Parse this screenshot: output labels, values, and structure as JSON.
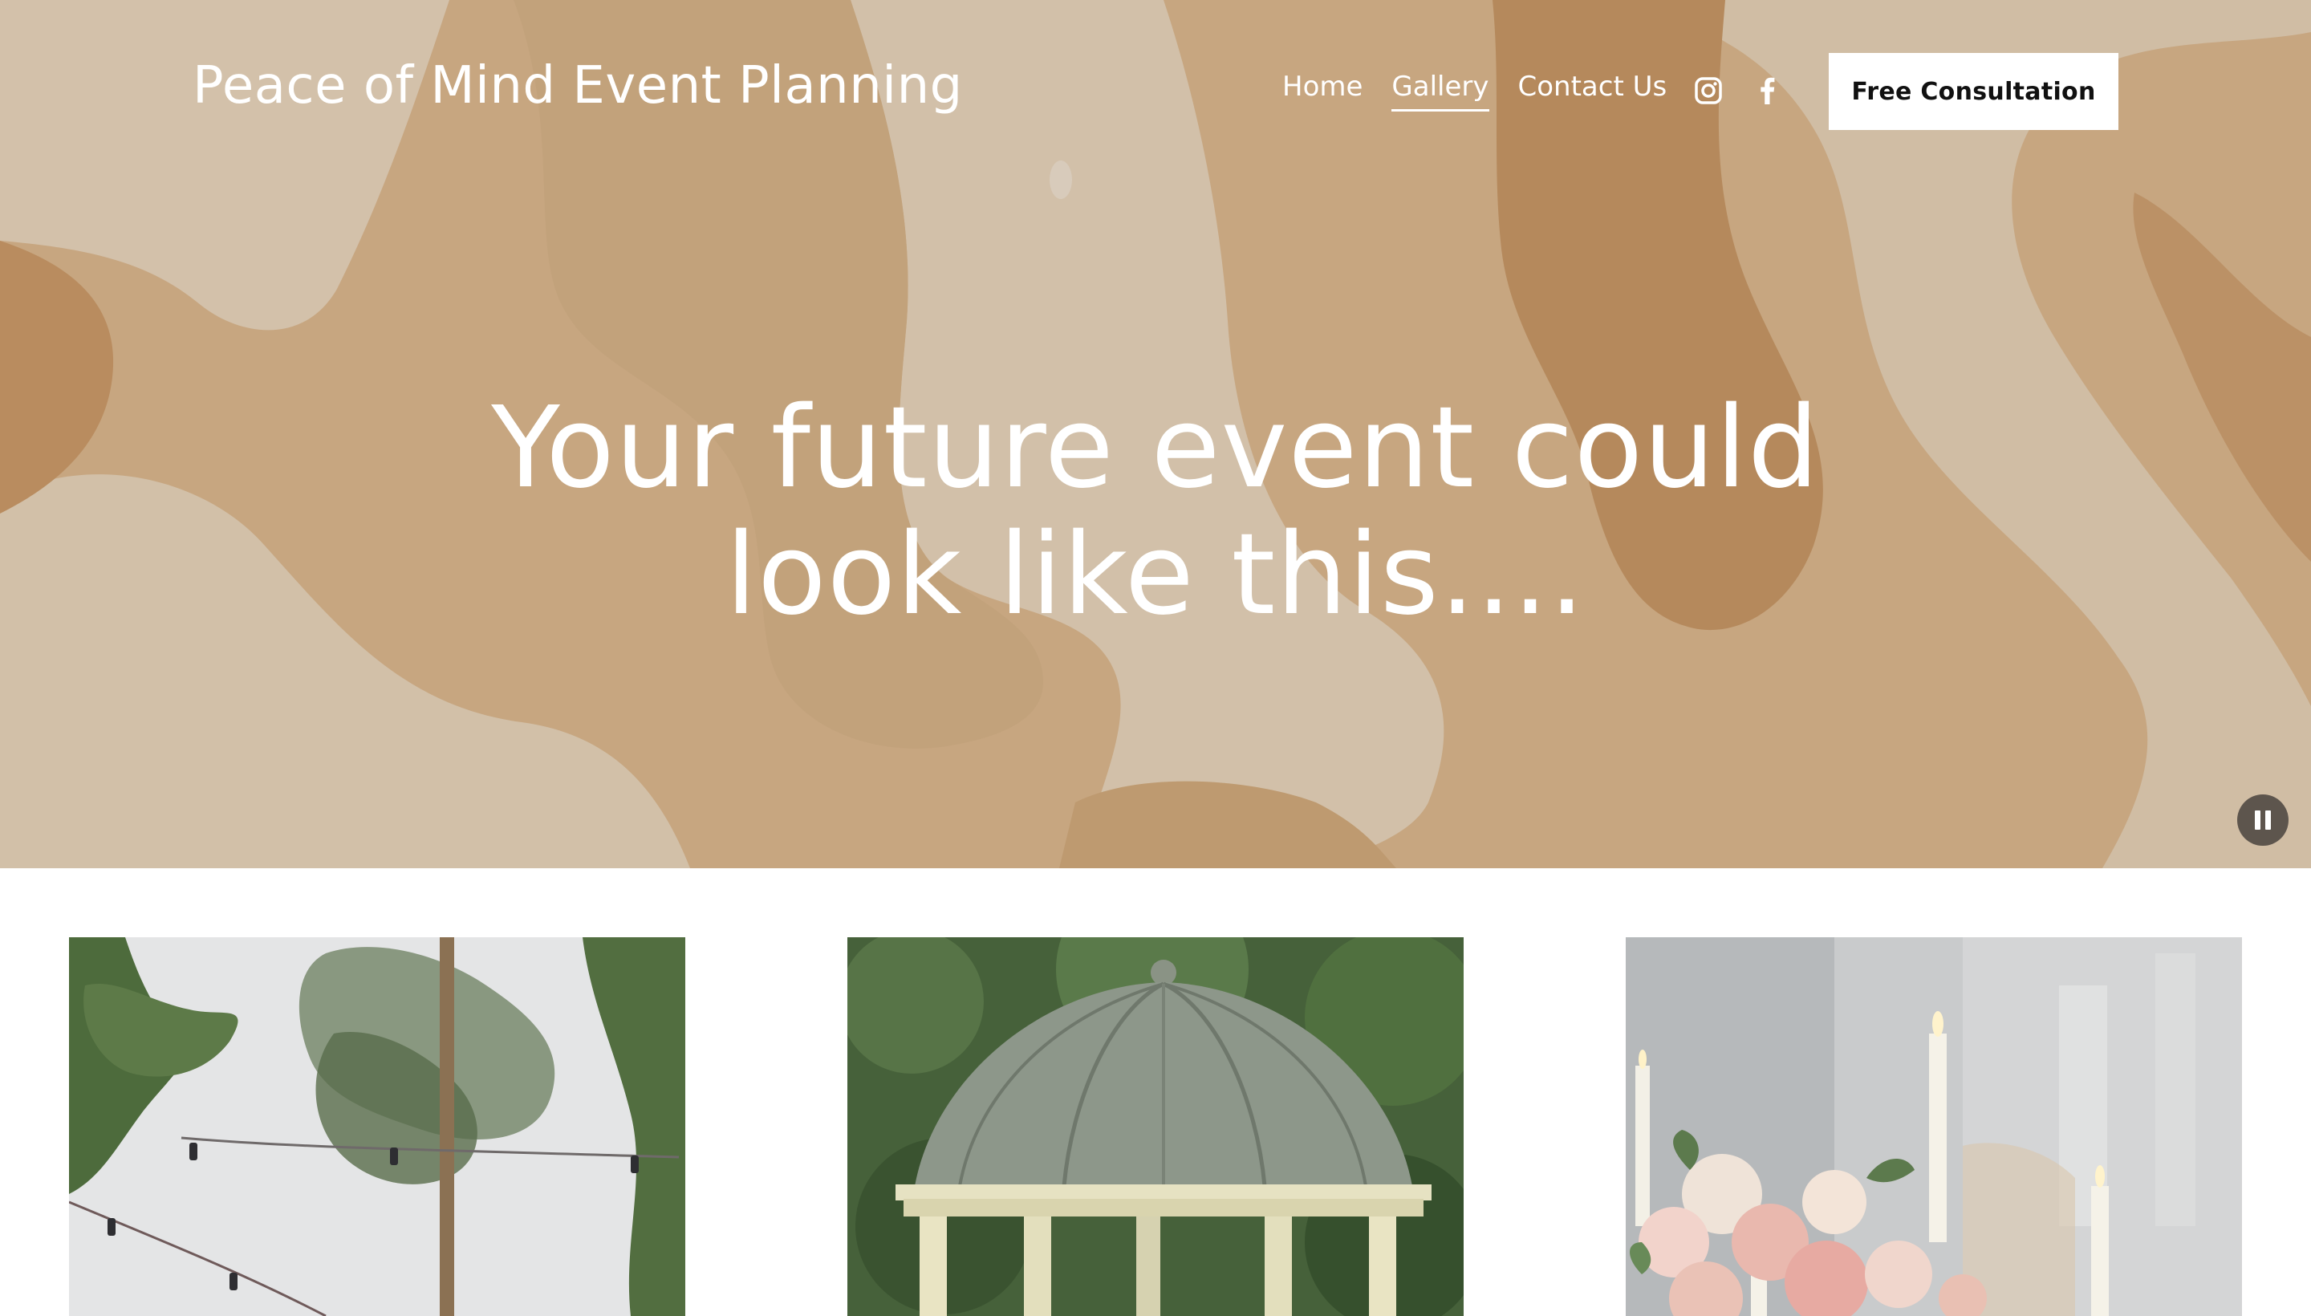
{
  "site": {
    "title": "Peace of Mind Event Planning"
  },
  "nav": {
    "items": [
      {
        "label": "Home",
        "active": false
      },
      {
        "label": "Gallery",
        "active": true
      },
      {
        "label": "Contact Us",
        "active": false
      }
    ]
  },
  "social": {
    "icons": [
      "instagram-icon",
      "facebook-icon"
    ]
  },
  "header": {
    "cta_label": "Free Consultation"
  },
  "hero": {
    "headline_line1": "Your future event could",
    "headline_line2": "look like this....",
    "colors": {
      "base": "#c9a883",
      "light": "#d4c3ad",
      "dark": "#b98d61"
    }
  },
  "slideshow": {
    "control": "pause-icon"
  },
  "gallery": {
    "images": [
      "string-lights-trees",
      "garden-gazebo-dome",
      "floral-centerpiece-candles"
    ]
  }
}
